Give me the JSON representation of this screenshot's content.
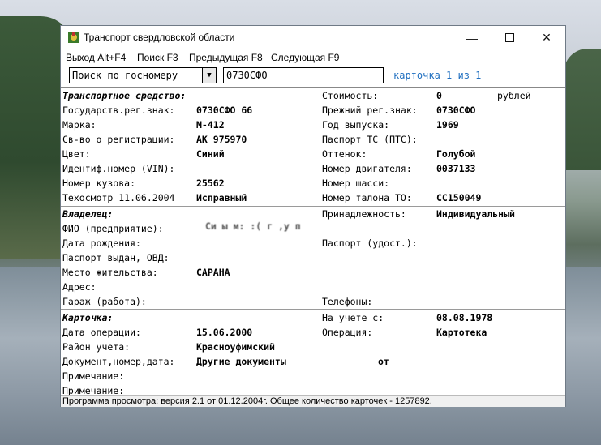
{
  "window": {
    "title": "Транспорт свердловской области"
  },
  "menu": [
    {
      "label": "Выход Alt+F4"
    },
    {
      "label": "Поиск F3"
    },
    {
      "label": "Предыдущая F8"
    },
    {
      "label": "Следующая F9"
    }
  ],
  "search": {
    "mode": "Поиск по госномеру",
    "value": "0730СФО",
    "counter": "карточка 1 из 1"
  },
  "vehicle": {
    "section": "Транспортное средство:",
    "reg_label": "Государств.рег.знак:",
    "reg": "0730СФО 66",
    "brand_label": "Марка:",
    "brand": "М-412",
    "cert_label": "Св-во о регистрации:",
    "cert": "АК 975970",
    "color_label": "Цвет:",
    "color": "Синий",
    "vin_label": "Идентиф.номер (VIN):",
    "body_label": "Номер кузова:",
    "body": "25562",
    "inspect_label": "Техосмотр 11.06.2004",
    "inspect": "Исправный",
    "cost_label": "Стоимость:",
    "cost": "0",
    "cost_unit": "рублей",
    "prev_reg_label": "Прежний рег.знак:",
    "prev_reg": "0730СФО",
    "year_label": "Год выпуска:",
    "year": "1969",
    "pts_label": "Паспорт ТС (ПТС):",
    "shade_label": "Оттенок:",
    "shade": "Голубой",
    "engine_label": "Номер двигателя:",
    "engine": "0037133",
    "chassis_label": "Номер шасси:",
    "ticket_label": "Номер талона ТО:",
    "ticket": "СС150049"
  },
  "owner": {
    "section": "Владелец:",
    "fio_label": "ФИО (предприятие):",
    "fio": "Си   ы       м: :( г   ,у   п",
    "belong_label": "Принадлежность:",
    "belong": "Индивидуальный",
    "birth_label": "Дата рождения:",
    "passport_label": "Паспорт (удост.):",
    "issued_label": "Паспорт выдан, ОВД:",
    "residence_label": "Место жительства:",
    "residence": "САРАНА",
    "address_label": "Адрес:",
    "garage_label": "Гараж (работа):",
    "phones_label": "Телефоны:"
  },
  "card": {
    "section": "Карточка:",
    "registered_label": "На учете с:",
    "registered": "08.08.1978",
    "op_date_label": "Дата операции:",
    "op_date": "15.06.2000",
    "operation_label": "Операция:",
    "operation": "Картотека",
    "district_label": "Район учета:",
    "district": "Красноуфимский",
    "doc_label": "Документ,номер,дата:",
    "doc": "Другие документы",
    "doc_from": "от",
    "note1_label": "Примечание:",
    "note2_label": "Примечание:"
  },
  "status": "Программа просмотра: версия 2.1 от 01.12.2004г.  Общее количество карточек - 1257892."
}
